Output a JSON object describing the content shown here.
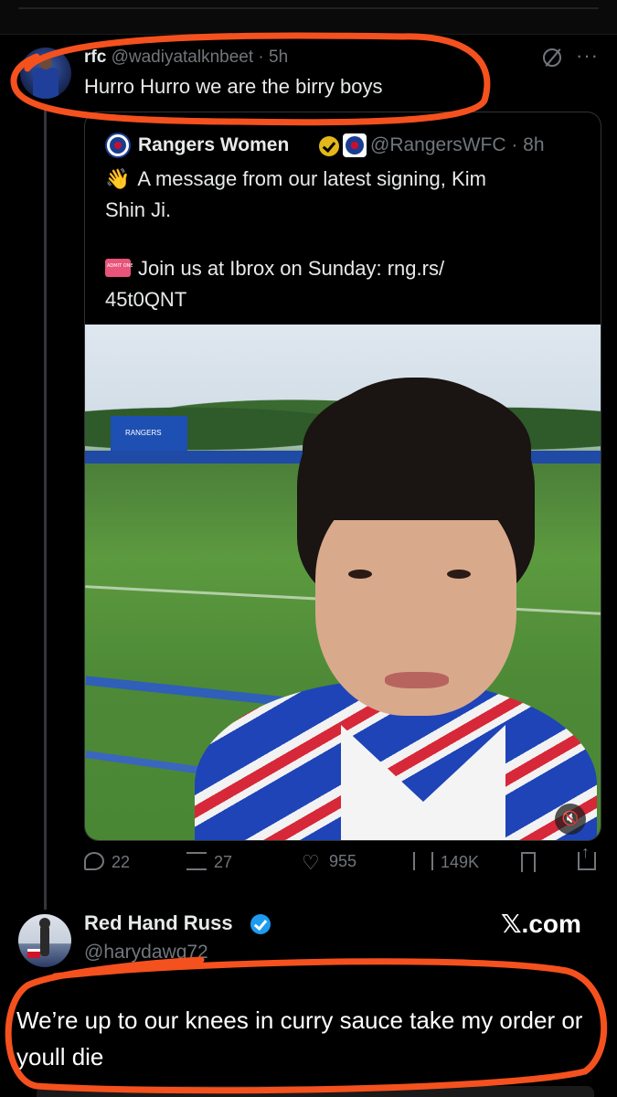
{
  "colors": {
    "background": "#000000",
    "text": "#e7e9ea",
    "muted": "#71767b",
    "circle_annotation": "#f4511e",
    "verified_gold": "#e2b719",
    "verified_blue": "#1d9bf0"
  },
  "tweet": {
    "name": "rfc",
    "handle_time": "@wadiyatalknbeet · 5h",
    "text": "Hurro Hurro we are the birry boys",
    "more": "···",
    "grok_icon": "grok-icon"
  },
  "quote": {
    "name": "Rangers Women",
    "handle_time": "@RangersWFC · 8h",
    "line1_emoji": "👋",
    "line1": "A message from our latest signing, Kim",
    "line2": "Shin Ji.",
    "line3": "Join us at Ibrox on Sunday: rng.rs/",
    "line4": "45t0QNT",
    "ticket_icon": "ticket-icon",
    "mute_glyph": "🔇"
  },
  "actions": {
    "replies": "22",
    "reposts": "27",
    "likes": "955",
    "views": "149K"
  },
  "reply_card": {
    "name": "Red Hand Russ",
    "handle": "@harydawg72",
    "brand": "𝕏.com",
    "text": "We’re up to our knees in curry sauce take my order or youll die"
  }
}
